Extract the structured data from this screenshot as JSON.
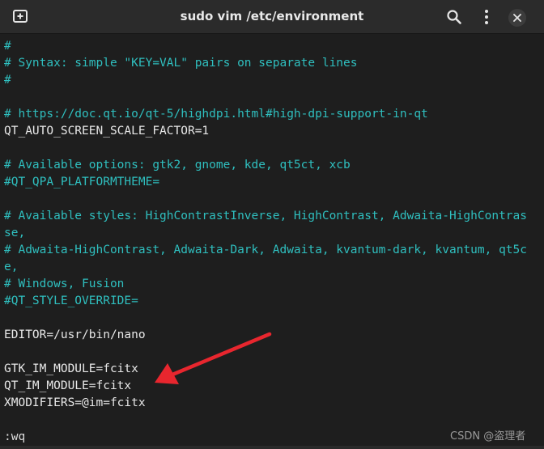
{
  "window": {
    "title": "sudo vim /etc/environment",
    "icons": {
      "new_tab": "new-tab-icon",
      "search": "search-icon",
      "menu": "kebab-menu-icon",
      "close": "close-icon"
    }
  },
  "editor": {
    "comment_color": "#2fbfbf",
    "text_color": "#e8e8e8",
    "background": "#1e1e1e",
    "lines": [
      {
        "text": "#",
        "kind": "comment"
      },
      {
        "text": "# Syntax: simple \"KEY=VAL\" pairs on separate lines",
        "kind": "comment"
      },
      {
        "text": "#",
        "kind": "comment"
      },
      {
        "text": "",
        "kind": "blank"
      },
      {
        "text": "# https://doc.qt.io/qt-5/highdpi.html#high-dpi-support-in-qt",
        "kind": "comment"
      },
      {
        "text": "QT_AUTO_SCREEN_SCALE_FACTOR=1",
        "kind": "text"
      },
      {
        "text": "",
        "kind": "blank"
      },
      {
        "text": "# Available options: gtk2, gnome, kde, qt5ct, xcb",
        "kind": "comment"
      },
      {
        "text": "#QT_QPA_PLATFORMTHEME=",
        "kind": "comment"
      },
      {
        "text": "",
        "kind": "blank"
      },
      {
        "text": "# Available styles: HighContrastInverse, HighContrast, Adwaita-HighContras",
        "kind": "comment"
      },
      {
        "text": "se,",
        "kind": "comment"
      },
      {
        "text": "# Adwaita-HighContrast, Adwaita-Dark, Adwaita, kvantum-dark, kvantum, qt5c",
        "kind": "comment"
      },
      {
        "text": "e,",
        "kind": "comment"
      },
      {
        "text": "# Windows, Fusion",
        "kind": "comment"
      },
      {
        "text": "#QT_STYLE_OVERRIDE=",
        "kind": "comment"
      },
      {
        "text": "",
        "kind": "blank"
      },
      {
        "text": "EDITOR=/usr/bin/nano",
        "kind": "text"
      },
      {
        "text": "",
        "kind": "blank"
      },
      {
        "text": "GTK_IM_MODULE=fcitx",
        "kind": "text"
      },
      {
        "text": "QT_IM_MODULE=fcitx",
        "kind": "text"
      },
      {
        "text": "XMODIFIERS=@im=fcitx",
        "kind": "text"
      },
      {
        "text": "",
        "kind": "blank"
      },
      {
        "text": ":wq",
        "kind": "status"
      }
    ]
  },
  "annotation": {
    "arrow_color": "#e8262e"
  },
  "watermark": "CSDN @盗理者"
}
